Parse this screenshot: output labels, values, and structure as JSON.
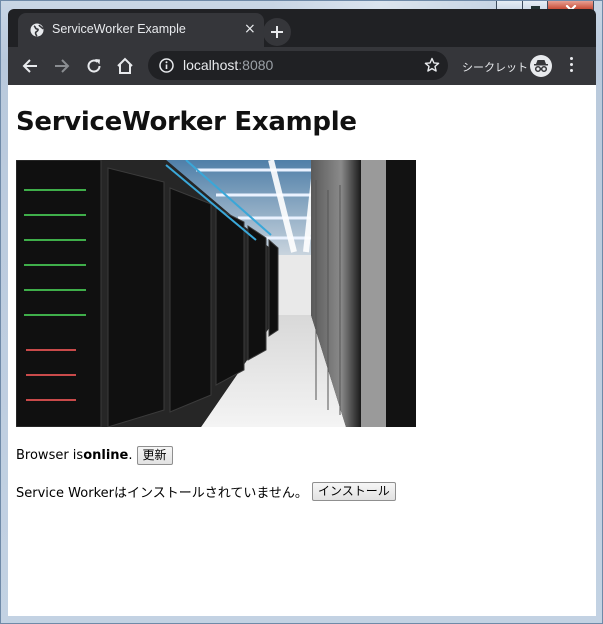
{
  "browser": {
    "tab_title": "ServiceWorker Example",
    "tab_close": "×",
    "url_host": "localhost",
    "url_port": ":8080",
    "incognito_label": "シークレット"
  },
  "page": {
    "title": "ServiceWorker Example",
    "status_prefix": "Browser is ",
    "status_value": "online",
    "status_suffix": ".",
    "refresh_button": "更新",
    "sw_status": "Service Workerはインストールされていません。",
    "install_button": "インストール"
  },
  "icons": [
    "globe-icon",
    "close-icon",
    "plus-icon",
    "back-arrow-icon",
    "forward-arrow-icon",
    "reload-icon",
    "home-icon",
    "info-icon",
    "star-icon",
    "incognito-icon",
    "menu-dots-icon",
    "minimize-icon",
    "maximize-icon",
    "close-window-icon"
  ],
  "colors": {
    "tabstrip": "#202124",
    "toolbar": "#35363a",
    "omnibox": "#202124",
    "text_light": "#e8eaed",
    "port_text": "#9aa0a6",
    "page_bg": "#ffffff"
  }
}
